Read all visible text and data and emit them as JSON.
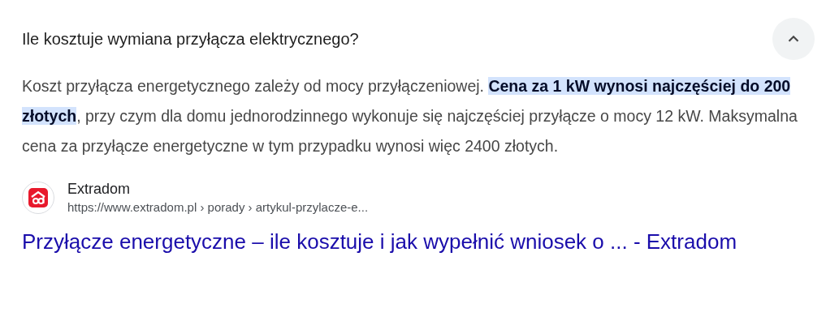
{
  "question": {
    "text": "Ile kosztuje wymiana przyłącza elektrycznego?",
    "expanded": true
  },
  "answer": "Koszt przyłącza energetycznego zależy od mocy przyłączeniowej. **Cena za 1 kW wynosi najczęściej do 200 złotych**, przy czym dla domu jednorodzinnego wykonuje się najczęściej przyłącze o mocy 12 kW. Maksymalna cena za przyłącze energetyczne w tym przypadku wynosi więc 2400 złotych.",
  "source": {
    "site_name": "Extradom",
    "url": "https://www.extradom.pl › porady › artykul-przylacze-e...",
    "title": "Przyłącze energetyczne – ile kosztuje i jak wypełnić wniosek o ... - Extradom"
  }
}
